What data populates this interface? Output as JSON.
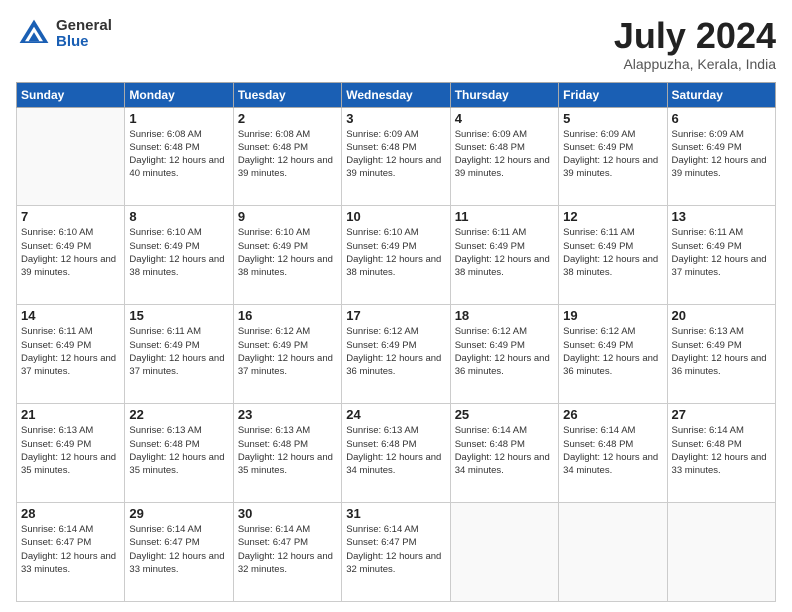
{
  "header": {
    "logo_general": "General",
    "logo_blue": "Blue",
    "month_title": "July 2024",
    "location": "Alappuzha, Kerala, India"
  },
  "days_of_week": [
    "Sunday",
    "Monday",
    "Tuesday",
    "Wednesday",
    "Thursday",
    "Friday",
    "Saturday"
  ],
  "weeks": [
    [
      {
        "day": "",
        "info": ""
      },
      {
        "day": "1",
        "info": "Sunrise: 6:08 AM\nSunset: 6:48 PM\nDaylight: 12 hours\nand 40 minutes."
      },
      {
        "day": "2",
        "info": "Sunrise: 6:08 AM\nSunset: 6:48 PM\nDaylight: 12 hours\nand 39 minutes."
      },
      {
        "day": "3",
        "info": "Sunrise: 6:09 AM\nSunset: 6:48 PM\nDaylight: 12 hours\nand 39 minutes."
      },
      {
        "day": "4",
        "info": "Sunrise: 6:09 AM\nSunset: 6:48 PM\nDaylight: 12 hours\nand 39 minutes."
      },
      {
        "day": "5",
        "info": "Sunrise: 6:09 AM\nSunset: 6:49 PM\nDaylight: 12 hours\nand 39 minutes."
      },
      {
        "day": "6",
        "info": "Sunrise: 6:09 AM\nSunset: 6:49 PM\nDaylight: 12 hours\nand 39 minutes."
      }
    ],
    [
      {
        "day": "7",
        "info": "Sunrise: 6:10 AM\nSunset: 6:49 PM\nDaylight: 12 hours\nand 39 minutes."
      },
      {
        "day": "8",
        "info": "Sunrise: 6:10 AM\nSunset: 6:49 PM\nDaylight: 12 hours\nand 38 minutes."
      },
      {
        "day": "9",
        "info": "Sunrise: 6:10 AM\nSunset: 6:49 PM\nDaylight: 12 hours\nand 38 minutes."
      },
      {
        "day": "10",
        "info": "Sunrise: 6:10 AM\nSunset: 6:49 PM\nDaylight: 12 hours\nand 38 minutes."
      },
      {
        "day": "11",
        "info": "Sunrise: 6:11 AM\nSunset: 6:49 PM\nDaylight: 12 hours\nand 38 minutes."
      },
      {
        "day": "12",
        "info": "Sunrise: 6:11 AM\nSunset: 6:49 PM\nDaylight: 12 hours\nand 38 minutes."
      },
      {
        "day": "13",
        "info": "Sunrise: 6:11 AM\nSunset: 6:49 PM\nDaylight: 12 hours\nand 37 minutes."
      }
    ],
    [
      {
        "day": "14",
        "info": "Sunrise: 6:11 AM\nSunset: 6:49 PM\nDaylight: 12 hours\nand 37 minutes."
      },
      {
        "day": "15",
        "info": "Sunrise: 6:11 AM\nSunset: 6:49 PM\nDaylight: 12 hours\nand 37 minutes."
      },
      {
        "day": "16",
        "info": "Sunrise: 6:12 AM\nSunset: 6:49 PM\nDaylight: 12 hours\nand 37 minutes."
      },
      {
        "day": "17",
        "info": "Sunrise: 6:12 AM\nSunset: 6:49 PM\nDaylight: 12 hours\nand 36 minutes."
      },
      {
        "day": "18",
        "info": "Sunrise: 6:12 AM\nSunset: 6:49 PM\nDaylight: 12 hours\nand 36 minutes."
      },
      {
        "day": "19",
        "info": "Sunrise: 6:12 AM\nSunset: 6:49 PM\nDaylight: 12 hours\nand 36 minutes."
      },
      {
        "day": "20",
        "info": "Sunrise: 6:13 AM\nSunset: 6:49 PM\nDaylight: 12 hours\nand 36 minutes."
      }
    ],
    [
      {
        "day": "21",
        "info": "Sunrise: 6:13 AM\nSunset: 6:49 PM\nDaylight: 12 hours\nand 35 minutes."
      },
      {
        "day": "22",
        "info": "Sunrise: 6:13 AM\nSunset: 6:48 PM\nDaylight: 12 hours\nand 35 minutes."
      },
      {
        "day": "23",
        "info": "Sunrise: 6:13 AM\nSunset: 6:48 PM\nDaylight: 12 hours\nand 35 minutes."
      },
      {
        "day": "24",
        "info": "Sunrise: 6:13 AM\nSunset: 6:48 PM\nDaylight: 12 hours\nand 34 minutes."
      },
      {
        "day": "25",
        "info": "Sunrise: 6:14 AM\nSunset: 6:48 PM\nDaylight: 12 hours\nand 34 minutes."
      },
      {
        "day": "26",
        "info": "Sunrise: 6:14 AM\nSunset: 6:48 PM\nDaylight: 12 hours\nand 34 minutes."
      },
      {
        "day": "27",
        "info": "Sunrise: 6:14 AM\nSunset: 6:48 PM\nDaylight: 12 hours\nand 33 minutes."
      }
    ],
    [
      {
        "day": "28",
        "info": "Sunrise: 6:14 AM\nSunset: 6:47 PM\nDaylight: 12 hours\nand 33 minutes."
      },
      {
        "day": "29",
        "info": "Sunrise: 6:14 AM\nSunset: 6:47 PM\nDaylight: 12 hours\nand 33 minutes."
      },
      {
        "day": "30",
        "info": "Sunrise: 6:14 AM\nSunset: 6:47 PM\nDaylight: 12 hours\nand 32 minutes."
      },
      {
        "day": "31",
        "info": "Sunrise: 6:14 AM\nSunset: 6:47 PM\nDaylight: 12 hours\nand 32 minutes."
      },
      {
        "day": "",
        "info": ""
      },
      {
        "day": "",
        "info": ""
      },
      {
        "day": "",
        "info": ""
      }
    ]
  ]
}
